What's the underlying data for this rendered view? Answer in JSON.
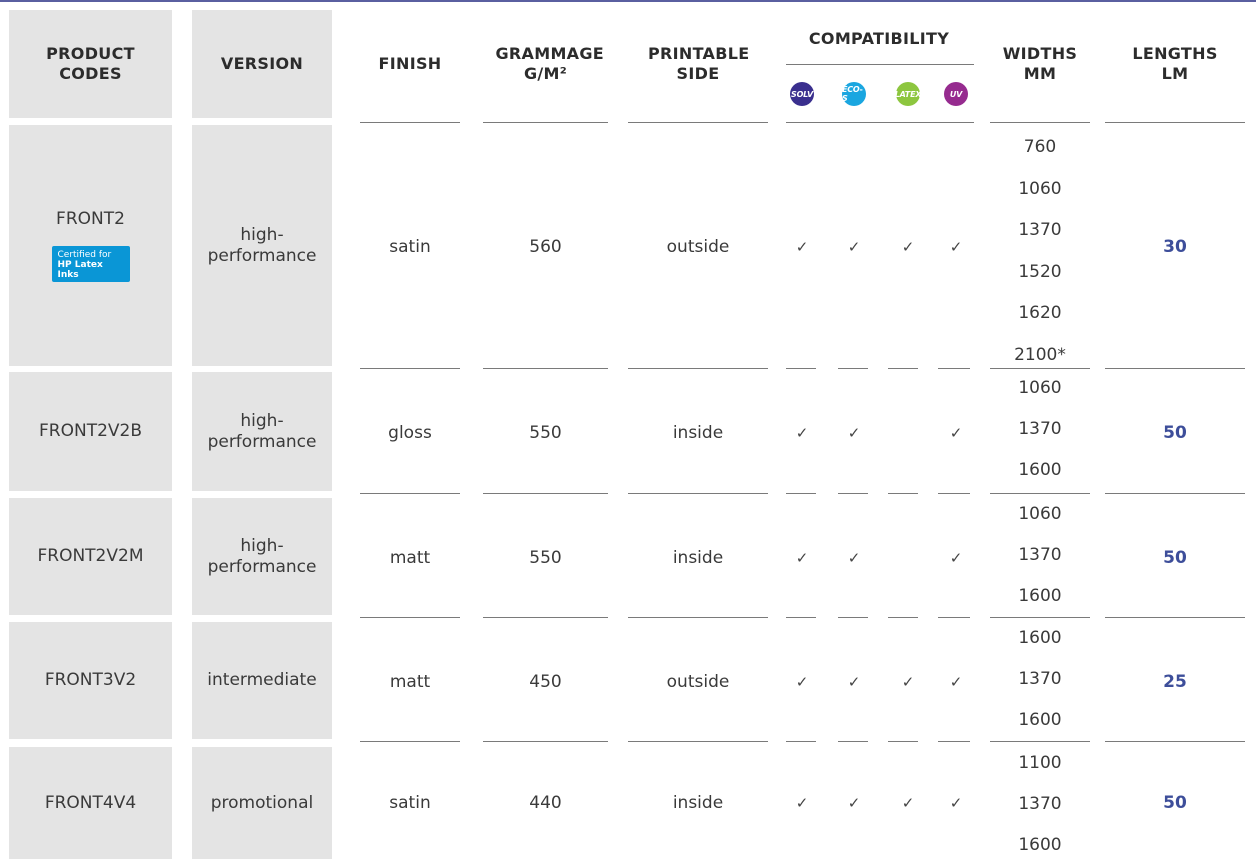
{
  "headers": {
    "product_codes": "PRODUCT CODES",
    "version": "VERSION",
    "finish": "FINISH",
    "grammage": "GRAMMAGE G/M²",
    "printable_side": "PRINTABLE SIDE",
    "compatibility": "COMPATIBILITY",
    "widths": "WIDTHS MM",
    "lengths": "LENGTHS LM",
    "inks": [
      {
        "label": "SOLV",
        "color": "#3a2f8e"
      },
      {
        "label": "ÉCO-S",
        "color": "#1aa6e0"
      },
      {
        "label": "LATEX",
        "color": "#8dc63f"
      },
      {
        "label": "UV",
        "color": "#962b8f"
      }
    ]
  },
  "badge": {
    "line1": "Certified for",
    "line2": "HP Latex Inks"
  },
  "check_mark": "✓",
  "rows": [
    {
      "code": "FRONT2",
      "version": "high-performance",
      "finish": "satin",
      "grammage": "560",
      "side": "outside",
      "compat": [
        true,
        true,
        true,
        true
      ],
      "widths": [
        "760",
        "1060",
        "1370",
        "1520",
        "1620",
        "2100*"
      ],
      "length": "30"
    },
    {
      "code": "FRONT2V2B",
      "version": "high-performance",
      "finish": "gloss",
      "grammage": "550",
      "side": "inside",
      "compat": [
        true,
        true,
        false,
        true
      ],
      "widths": [
        "1060",
        "1370",
        "1600"
      ],
      "length": "50"
    },
    {
      "code": "FRONT2V2M",
      "version": "high-performance",
      "finish": "matt",
      "grammage": "550",
      "side": "inside",
      "compat": [
        true,
        true,
        false,
        true
      ],
      "widths": [
        "1060",
        "1370",
        "1600"
      ],
      "length": "50"
    },
    {
      "code": "FRONT3V2",
      "version": "intermediate",
      "finish": "matt",
      "grammage": "450",
      "side": "outside",
      "compat": [
        true,
        true,
        true,
        true
      ],
      "widths": [
        "1600",
        "1370",
        "1600"
      ],
      "length": "25"
    },
    {
      "code": "FRONT4V4",
      "version": "promotional",
      "finish": "satin",
      "grammage": "440",
      "side": "inside",
      "compat": [
        true,
        true,
        true,
        true
      ],
      "widths": [
        "1100",
        "1370",
        "1600"
      ],
      "length": "50"
    }
  ]
}
